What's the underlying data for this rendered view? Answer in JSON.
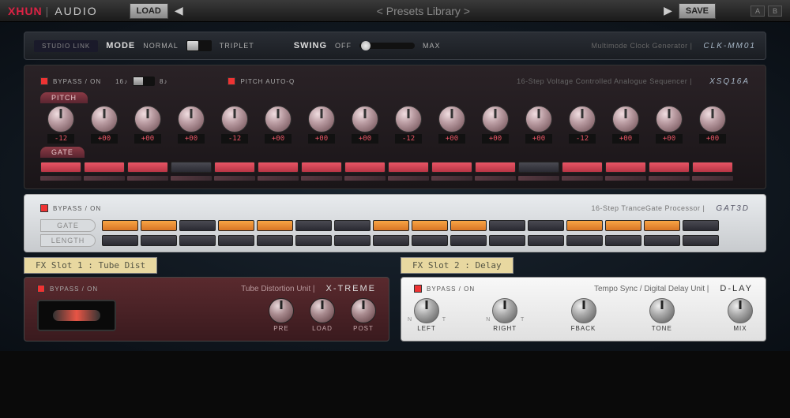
{
  "topbar": {
    "brand": "XHUN",
    "brand_sub": "AUDIO",
    "load": "LOAD",
    "save": "SAVE",
    "preset": "< Presets Library >"
  },
  "clock": {
    "studio_link": "STUDIO LINK",
    "mode": "MODE",
    "normal": "NORMAL",
    "triplet": "TRIPLET",
    "swing": "SWING",
    "off": "OFF",
    "max": "MAX",
    "desc": "Multimode Clock Generator |",
    "model": "CLK-MM01"
  },
  "seq": {
    "bypass": "BYPASS / ON",
    "s16": "16♪",
    "s8": "8♪",
    "pitch_auto": "PITCH AUTO-Q",
    "desc": "16-Step Voltage Controlled Analogue Sequencer |",
    "model": "XSQ16A",
    "pitch_tab": "PITCH",
    "gate_tab": "GATE",
    "pitch_vals": [
      "-12",
      "+00",
      "+00",
      "+00",
      "-12",
      "+00",
      "+00",
      "+00",
      "-12",
      "+00",
      "+00",
      "+00",
      "-12",
      "+00",
      "+00",
      "+00"
    ],
    "gate_states": [
      1,
      1,
      1,
      0,
      1,
      1,
      1,
      1,
      1,
      1,
      1,
      0,
      1,
      1,
      1,
      1
    ]
  },
  "gate": {
    "bypass": "BYPASS / ON",
    "desc": "16-Step TranceGate Processor |",
    "model": "GAT3D",
    "gate_tab": "GATE",
    "length_tab": "LENGTH",
    "gate_states": [
      1,
      1,
      0,
      1,
      1,
      0,
      0,
      1,
      1,
      1,
      0,
      0,
      1,
      1,
      1,
      0
    ],
    "length_states": [
      0,
      0,
      0,
      0,
      0,
      0,
      0,
      0,
      0,
      0,
      0,
      0,
      0,
      0,
      0,
      0
    ]
  },
  "fx1": {
    "tab": "FX Slot 1 : Tube Dist",
    "bypass": "BYPASS / ON",
    "title": "Tube Distortion Unit |",
    "model": "X-TREME",
    "knobs": [
      "PRE",
      "LOAD",
      "POST"
    ]
  },
  "fx2": {
    "tab": "FX Slot 2 : Delay",
    "bypass": "BYPASS / ON",
    "title": "Tempo Sync / Digital Delay Unit |",
    "model": "D-LAY",
    "knobs": [
      "LEFT",
      "RIGHT",
      "FBACK",
      "TONE",
      "MIX"
    ],
    "n": "N",
    "t": "T"
  }
}
